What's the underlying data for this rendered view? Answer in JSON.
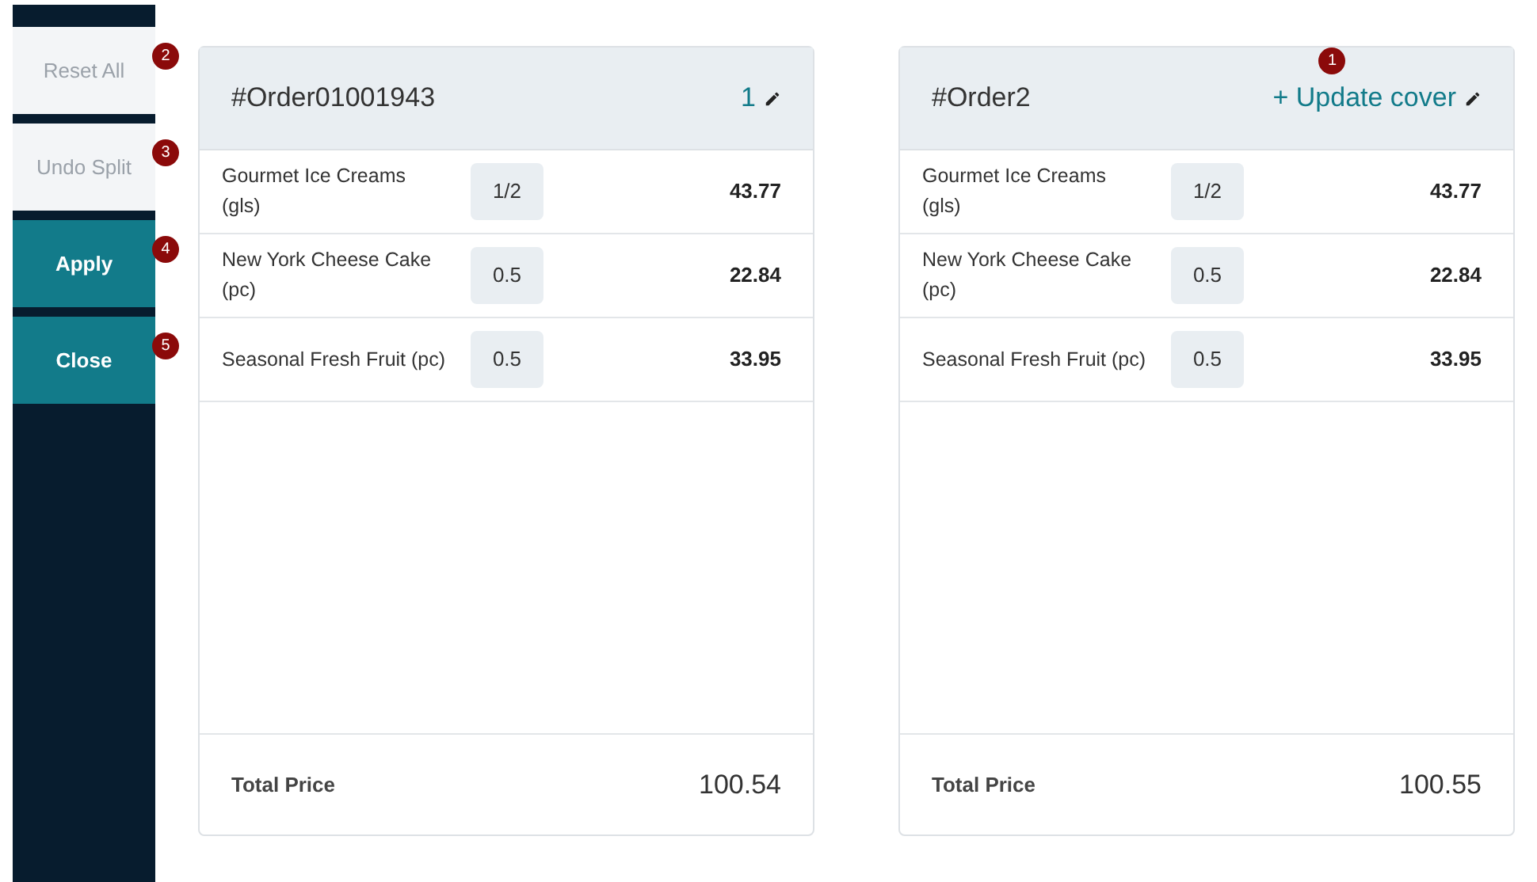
{
  "sidebar": {
    "buttons": [
      {
        "label": "Reset All",
        "disabled": true,
        "badge": "2"
      },
      {
        "label": "Undo Split",
        "disabled": true,
        "badge": "3"
      },
      {
        "label": "Apply",
        "disabled": false,
        "badge": "4"
      },
      {
        "label": "Close",
        "disabled": false,
        "badge": "5"
      }
    ]
  },
  "orders": [
    {
      "title": "#Order01001943",
      "cover": {
        "text": "1"
      },
      "items": [
        {
          "name": "Gourmet Ice Creams (gls)",
          "quantity": "1/2",
          "price": "43.77"
        },
        {
          "name": "New York Cheese Cake (pc)",
          "quantity": "0.5",
          "price": "22.84"
        },
        {
          "name": "Seasonal Fresh Fruit (pc)",
          "quantity": "0.5",
          "price": "33.95"
        }
      ],
      "total_label": "Total Price",
      "total": "100.54"
    },
    {
      "title": "#Order2",
      "cover": {
        "text": "+ Update cover",
        "badge": "1"
      },
      "items": [
        {
          "name": "Gourmet Ice Creams (gls)",
          "quantity": "1/2",
          "price": "43.77"
        },
        {
          "name": "New York Cheese Cake (pc)",
          "quantity": "0.5",
          "price": "22.84"
        },
        {
          "name": "Seasonal Fresh Fruit (pc)",
          "quantity": "0.5",
          "price": "33.95"
        }
      ],
      "total_label": "Total Price",
      "total": "100.55"
    }
  ]
}
